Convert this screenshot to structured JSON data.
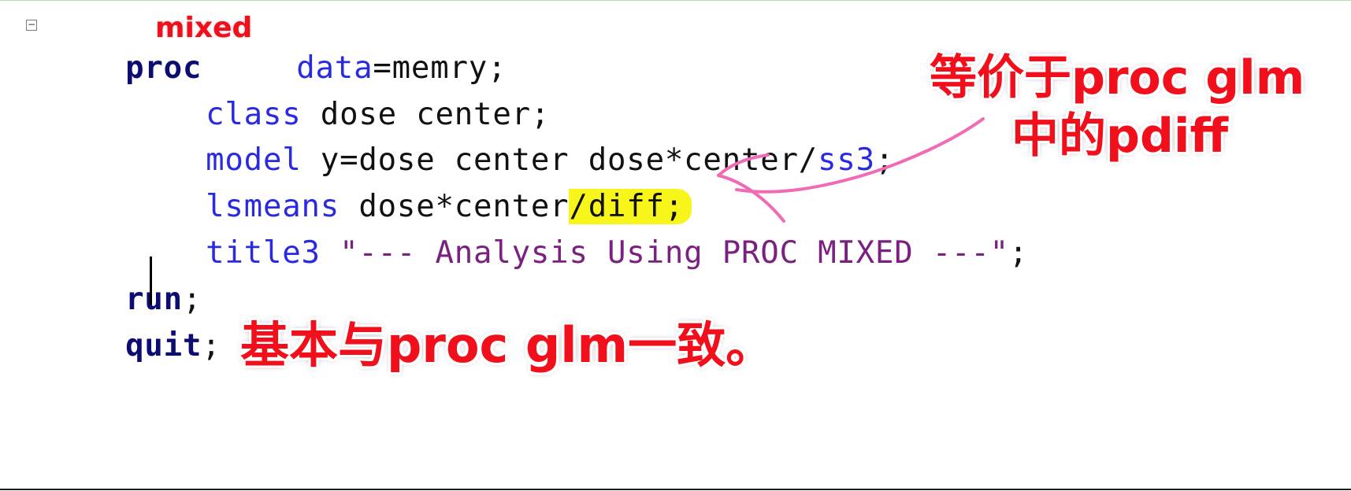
{
  "editor": {
    "fold_symbol": "−",
    "lines": [
      {
        "kw": "proc",
        "rest": " data=memry;"
      },
      {
        "kw": "class",
        "rest": " dose center;"
      },
      {
        "kw": "model",
        "rest": " y=dose center dose*center/",
        "opt": "ss3",
        "end": ";"
      },
      {
        "kw": "lsmeans",
        "rest": " dose*center",
        "hl": "/diff;"
      },
      {
        "kw": "title3",
        "rest": " ",
        "str": "\"--- Analysis Using PROC MIXED ---\"",
        "end": ";"
      },
      {
        "kw": "run",
        "end": ";"
      },
      {
        "kw": "quit",
        "end": ";"
      }
    ]
  },
  "annotations": {
    "mixed": "mixed",
    "pdiff_line1": "等价于proc glm",
    "pdiff_line2": "中的pdiff",
    "summary": "基本与proc glm一致。"
  },
  "colors": {
    "keyword": "#0c0c72",
    "option": "#2a2ae0",
    "string": "#7a2080",
    "annotation": "#f20f1c",
    "highlight": "#f7f51a",
    "arrow": "#f06ab4"
  }
}
